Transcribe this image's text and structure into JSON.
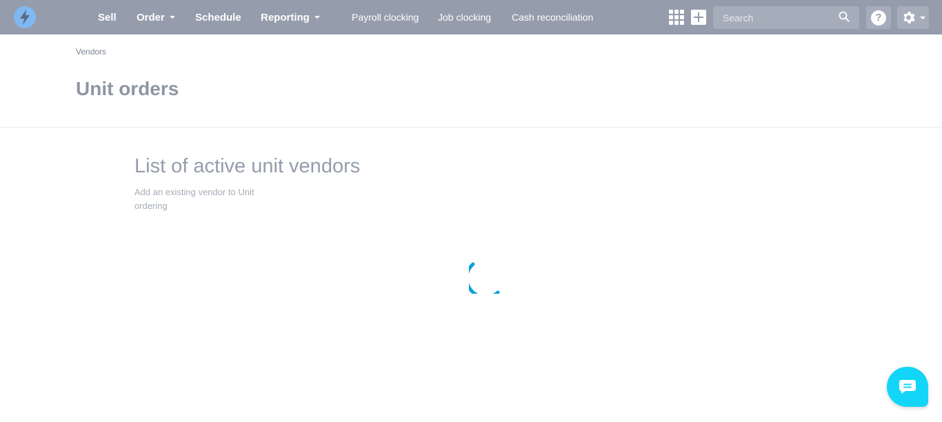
{
  "topbar": {
    "logo": "bolt-logo-icon",
    "nav_main": [
      {
        "label": "Sell",
        "dropdown": false
      },
      {
        "label": "Order",
        "dropdown": true
      },
      {
        "label": "Schedule",
        "dropdown": false
      },
      {
        "label": "Reporting",
        "dropdown": true
      }
    ],
    "nav_sub": [
      {
        "label": "Payroll clocking"
      },
      {
        "label": "Job clocking"
      },
      {
        "label": "Cash reconciliation"
      }
    ],
    "search": {
      "placeholder": "Search",
      "value": ""
    },
    "help_label": "?",
    "icons": [
      "apps-grid-icon",
      "plus-icon",
      "search-icon",
      "help-icon",
      "gear-icon"
    ],
    "colors": {
      "bar": "#959cab",
      "control_bg": "#a5acba"
    }
  },
  "header": {
    "breadcrumb": "Vendors",
    "title": "Unit orders"
  },
  "main": {
    "section_title": "List of active unit vendors",
    "section_description": "Add an existing vendor to Unit ordering",
    "loading": true,
    "spinner_color": "#0aa3dc"
  },
  "chat": {
    "icon": "chat-bubble-icon",
    "color": "#13d5f7"
  }
}
